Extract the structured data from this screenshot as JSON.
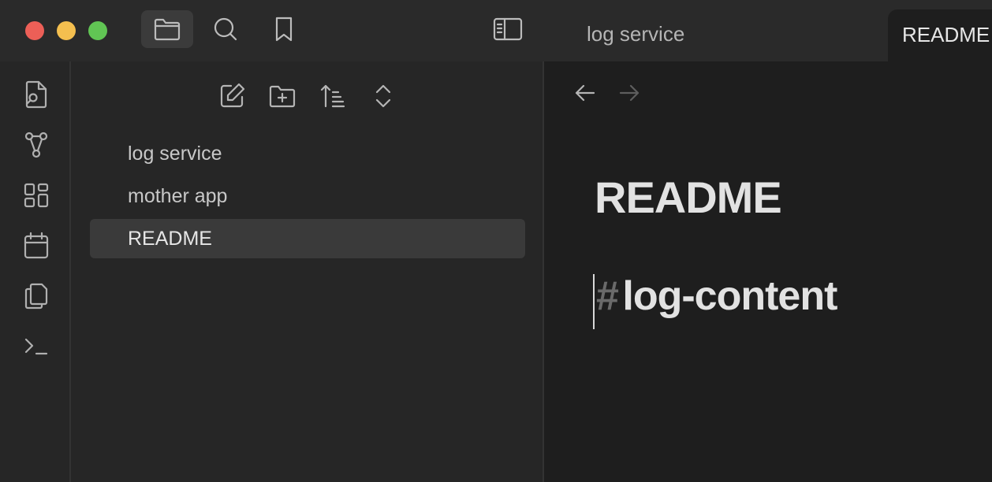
{
  "titlebar": {
    "tab_title": "log service",
    "active_tab_label": "README",
    "icons": [
      "folder-icon",
      "search-icon",
      "bookmark-icon",
      "sidebar-toggle-icon"
    ]
  },
  "ribbon": {
    "icons": [
      "file-search-icon",
      "graph-icon",
      "dashboard-icon",
      "calendar-icon",
      "copy-icon",
      "terminal-icon"
    ]
  },
  "explorer": {
    "toolbar_icons": [
      "new-note-icon",
      "new-folder-icon",
      "sort-icon",
      "collapse-icon"
    ],
    "files": [
      {
        "label": "log service",
        "selected": false
      },
      {
        "label": "mother app",
        "selected": false
      },
      {
        "label": "README",
        "selected": true
      }
    ]
  },
  "editor": {
    "title": "README",
    "heading_marker": "#",
    "heading_text": "log-content"
  },
  "colors": {
    "close": "#ec5f57",
    "minimize": "#f4bf4f",
    "zoom": "#61c554",
    "background": "#1e1e1e",
    "sidebar": "#262626",
    "selection": "#3a3a3a"
  }
}
